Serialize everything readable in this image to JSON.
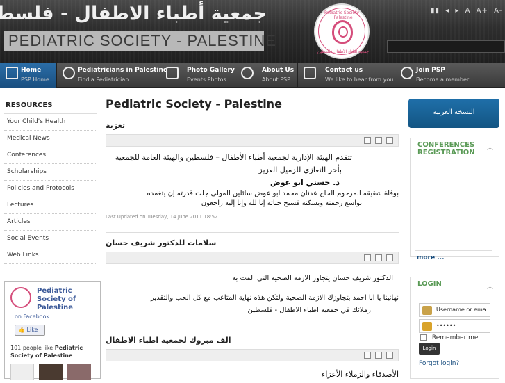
{
  "header": {
    "arabic_title": "جمعية أطباء الاطفال - فلسطين",
    "english_title": "PEDIATRIC SOCIETY - PALESTINE",
    "logo_text_top": "Pediatric Society - Palestine",
    "logo_text_bottom": "جمعية أطباء الأطفال فلسطين",
    "tools": [
      "▮▮",
      "◂",
      "▸",
      "A",
      "A+",
      "A-"
    ]
  },
  "nav": [
    {
      "label": "Home",
      "sub": "PSP Home",
      "icon": "home-icon"
    },
    {
      "label": "Pediatricians in Palestine",
      "sub": "Find a Pediatrician",
      "icon": "doctor-icon"
    },
    {
      "label": "Photo Gallery",
      "sub": "Events Photos",
      "icon": "photo-icon"
    },
    {
      "label": "About Us",
      "sub": "About PSP",
      "icon": "info-icon"
    },
    {
      "label": "Contact us",
      "sub": "We like to hear from you",
      "icon": "contact-icon"
    },
    {
      "label": "Join PSP",
      "sub": "Become a member",
      "icon": "join-icon"
    }
  ],
  "sidebar": {
    "title": "RESOURCES",
    "items": [
      "Your Child's Health",
      "Medical News",
      "Conferences",
      "Scholarships",
      "Policies and Protocols",
      "Lectures",
      "Articles",
      "Social Events",
      "Web Links"
    ]
  },
  "facebook": {
    "name": "Pediatric Society of Palestine",
    "on": "on",
    "source": "Facebook",
    "like": "Like",
    "count_text": "101 people like",
    "page_name": "Pediatric Society of Palestine",
    "period": "."
  },
  "main": {
    "page_title": "Pediatric Society - Palestine",
    "articles": [
      {
        "title": "تعزية",
        "lines": [
          "تتقدم الهيئة الإدارية لجمعية أطباء الأطفال – فلسطين والهيئة  العامة للجمعية",
          "بأحر التعازي للزميل العزيز",
          "د. حسني ابو عوض",
          "بوفاة شقيقه المرحوم الحاج عدنان محمد ابو عوض سائلين المولى جلت قدرته إن يتغمده",
          "بواسع رحمته ويسكنه فسيح جناته إنا لله وإنا إليه راجعون"
        ],
        "updated": "Last Updated on Tuesday, 14 June 2011 18:52"
      },
      {
        "title": "سلامات للدكتور شريف حسان",
        "lines": [
          "الدكتور شريف حسان يتجاوز الازمة الصحية التي المت به",
          "نهانينا يا ابا احمد بتجاوزك الازمة الصحية ولتكن هذه نهاية المتاعب   مع كل الحب والتقدير",
          "زملائك في جمعية اطباء الاطفال - فلسطين"
        ]
      },
      {
        "title": "الف مبروك لجمعية اطباء الاطفال",
        "lines": [
          "الأصدقاء والزملاء الأعزاء"
        ]
      }
    ]
  },
  "right": {
    "arabic_version": "النسخة العربية",
    "conferences_title": "CONFERENCES REGISTRATION",
    "more": "more ...",
    "login_title": "LOGIN",
    "username_placeholder": "Username or ema",
    "password_mask": "••••••",
    "remember": "Remember me",
    "login_button": "Login",
    "forgot": "Forgot login?"
  },
  "colors": {
    "nav_active": "#1a4f80",
    "box_title": "#5a9a56",
    "link": "#1a4f80"
  }
}
